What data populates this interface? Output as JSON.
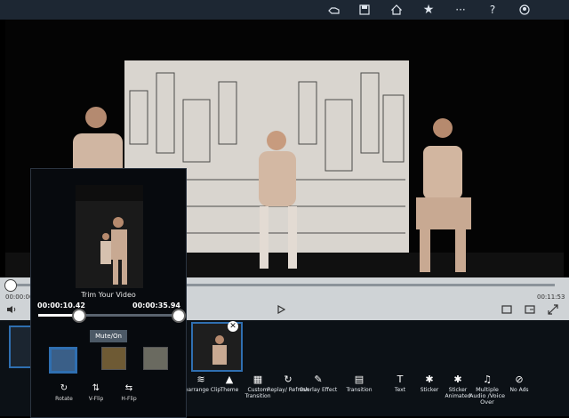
{
  "topbar": {
    "icons": [
      "hand-icon",
      "save-icon",
      "home-icon",
      "star-icon",
      "more-icon",
      "help-icon",
      "account-icon"
    ]
  },
  "player": {
    "time_current": "00:00:00",
    "time_total": "00:11:53"
  },
  "trim": {
    "title": "Trim Your Video",
    "start_time": "00:00:10.42",
    "end_time": "00:00:35.94",
    "mute_label": "Mute/On",
    "tools": [
      "Rotate",
      "V-Flip",
      "H-Flip"
    ]
  },
  "toolbar": {
    "items": [
      {
        "label": "Rearrange Clip"
      },
      {
        "label": "Theme"
      },
      {
        "label": "Custom Transition"
      },
      {
        "label": "Replay/ Refresh"
      },
      {
        "label": "Overlay Effect"
      },
      {
        "label": "Transition"
      },
      {
        "label": "Text"
      },
      {
        "label": "Sticker"
      },
      {
        "label": "Sticker Animated"
      },
      {
        "label": "Multiple Audio /Voice Over"
      },
      {
        "label": "No Ads"
      }
    ]
  },
  "colors": {
    "accent": "#2f6fb1",
    "topbar": "#1d2733",
    "controls": "#cfd3d6"
  }
}
